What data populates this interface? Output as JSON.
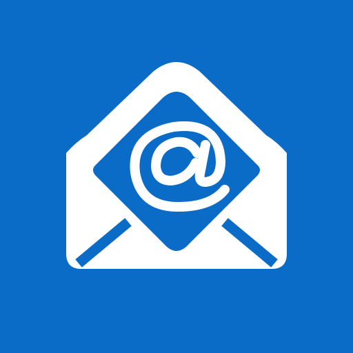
{
  "app_icon": {
    "name": "email-app-icon",
    "icon": "open-envelope-icon",
    "symbol": "@",
    "colors": {
      "background": "#0A6CC7",
      "foreground": "#FFFFFF"
    }
  }
}
